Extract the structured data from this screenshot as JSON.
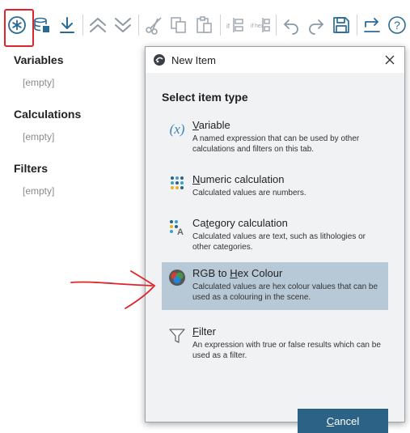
{
  "toolbar": {
    "buttons": [
      {
        "name": "new-item-button",
        "icon": "asterisk-circle-icon"
      },
      {
        "name": "import-button",
        "icon": "database-import-icon"
      },
      {
        "name": "download-button",
        "icon": "download-arrow-icon"
      },
      {
        "name": "move-up-button",
        "icon": "double-chevron-up-icon"
      },
      {
        "name": "move-down-button",
        "icon": "double-chevron-down-icon"
      },
      {
        "name": "cut-button",
        "icon": "scissors-icon"
      },
      {
        "name": "copy-button",
        "icon": "copy-icon"
      },
      {
        "name": "paste-button",
        "icon": "paste-icon"
      },
      {
        "name": "insert-if-button",
        "icon": "if-block-icon",
        "label": "if"
      },
      {
        "name": "insert-ifhex-button",
        "icon": "if-hex-block-icon",
        "label": "if hex"
      },
      {
        "name": "undo-button",
        "icon": "undo-icon"
      },
      {
        "name": "redo-button",
        "icon": "redo-icon"
      },
      {
        "name": "save-button",
        "icon": "save-icon"
      },
      {
        "name": "export-button",
        "icon": "export-arrow-icon"
      },
      {
        "name": "help-button",
        "icon": "help-icon",
        "label": "?"
      }
    ]
  },
  "left_panel": {
    "sections": [
      {
        "title": "Variables",
        "empty": "[empty]"
      },
      {
        "title": "Calculations",
        "empty": "[empty]"
      },
      {
        "title": "Filters",
        "empty": "[empty]"
      }
    ]
  },
  "dialog": {
    "title": "New Item",
    "heading": "Select item type",
    "items": [
      {
        "name_first": "V",
        "name_rest": "ariable",
        "desc": "A named expression that can be used by other calculations and filters on this tab.",
        "icon": "variable-x-icon",
        "selected": false
      },
      {
        "name_first": "N",
        "name_rest": "umeric calculation",
        "desc": "Calculated values are numbers.",
        "icon": "numeric-dots-icon",
        "selected": false
      },
      {
        "name_first": "Ca",
        "name_u": "t",
        "name_rest": "egory calculation",
        "desc": "Calculated values are text, such as lithologies or other categories.",
        "icon": "category-dots-icon",
        "selected": false
      },
      {
        "name_first": "RGB to ",
        "name_u": "H",
        "name_rest": "ex Colour",
        "desc": "Calculated values are hex colour values that can be used as a colouring in the scene.",
        "icon": "rgb-circles-icon",
        "selected": true
      },
      {
        "name_first": "F",
        "name_rest": "ilter",
        "desc": "An expression with true or false results which can be used as a filter.",
        "icon": "funnel-icon",
        "selected": false
      }
    ],
    "cancel_first": "C",
    "cancel_rest": "ancel"
  },
  "colors": {
    "accent": "#2b6286",
    "selected_bg": "#b7c9d6",
    "annotation_red": "#e0242a",
    "toolbar_blue": "#2a6b94"
  }
}
